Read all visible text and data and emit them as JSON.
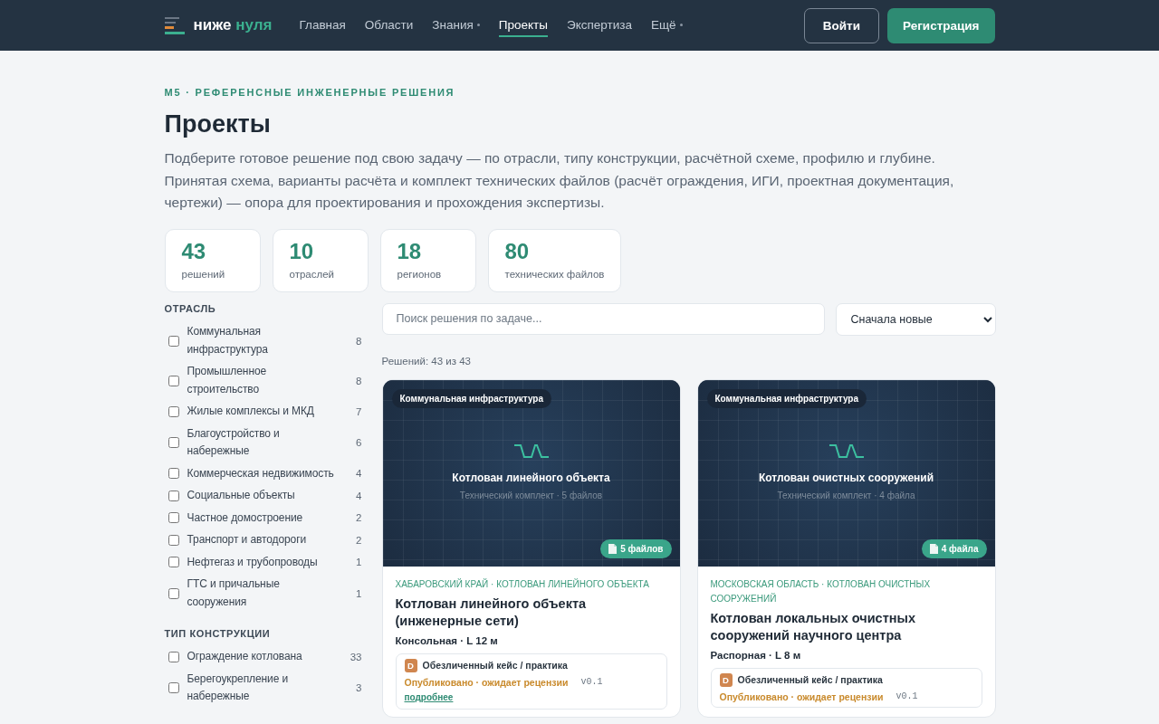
{
  "header": {
    "logo": {
      "word1": "ниже",
      "word2": "нуля"
    },
    "nav": [
      {
        "label": "Главная",
        "selected": false,
        "dropdown": false
      },
      {
        "label": "Области",
        "selected": false,
        "dropdown": false
      },
      {
        "label": "Знания",
        "selected": false,
        "dropdown": true
      },
      {
        "label": "Проекты",
        "selected": true,
        "dropdown": false
      },
      {
        "label": "Экспертиза",
        "selected": false,
        "dropdown": false
      },
      {
        "label": "Ещё",
        "selected": false,
        "dropdown": true
      }
    ],
    "login": "Войти",
    "register": "Регистрация"
  },
  "eyebrow": "M5 · РЕФЕРЕНСНЫЕ ИНЖЕНЕРНЫЕ РЕШЕНИЯ",
  "title": "Проекты",
  "intro": "Подберите готовое решение под свою задачу — по отрасли, типу конструкции, расчётной схеме, профилю и глубине. Принятая схема, варианты расчёта и комплект технических файлов (расчёт ограждения, ИГИ, проектная документация, чертежи) — опора для проектирования и прохождения экспертизы.",
  "stats": [
    {
      "value": "43",
      "label": "решений"
    },
    {
      "value": "10",
      "label": "отраслей"
    },
    {
      "value": "18",
      "label": "регионов"
    },
    {
      "value": "80",
      "label": "технических файлов"
    }
  ],
  "filters": [
    {
      "title": "ОТРАСЛЬ",
      "items": [
        {
          "label": "Коммунальная инфраструктура",
          "count": "8",
          "checked": false
        },
        {
          "label": "Промышленное строительство",
          "count": "8",
          "checked": false
        },
        {
          "label": "Жилые комплексы и МКД",
          "count": "7",
          "checked": false
        },
        {
          "label": "Благоустройство и набережные",
          "count": "6",
          "checked": false
        },
        {
          "label": "Коммерческая недвижимость",
          "count": "4",
          "checked": false
        },
        {
          "label": "Социальные объекты",
          "count": "4",
          "checked": false
        },
        {
          "label": "Частное домостроение",
          "count": "2",
          "checked": false
        },
        {
          "label": "Транспорт и автодороги",
          "count": "2",
          "checked": false
        },
        {
          "label": "Нефтегаз и трубопроводы",
          "count": "1",
          "checked": false
        },
        {
          "label": "ГТС и причальные сооружения",
          "count": "1",
          "checked": false
        }
      ]
    },
    {
      "title": "ТИП КОНСТРУКЦИИ",
      "items": [
        {
          "label": "Ограждение котлована",
          "count": "33",
          "checked": false
        },
        {
          "label": "Берегоукрепление и набережные",
          "count": "3",
          "checked": false
        }
      ]
    }
  ],
  "search": {
    "placeholder": "Поиск решения по задаче..."
  },
  "sort": {
    "value": "Сначала новые"
  },
  "result_count": "Решений: 43 из 43",
  "cards": [
    {
      "category": "Коммунальная инфраструктура",
      "cover_title": "Котлован линейного объекта",
      "cover_subtitle": "Технический комплект · 5 файлов",
      "files": "5 файлов",
      "meta": "ХАБАРОВСКИЙ КРАЙ · КОТЛОВАН ЛИНЕЙНОГО ОБЪЕКТА",
      "title": "Котлован линейного объекта (инженерные сети)",
      "spec": "Консольная · L 12 м",
      "source": {
        "badge": "D",
        "label": "Обезличенный кейс / практика",
        "status": "Опубликовано · ожидает рецензии",
        "version": "v0.1",
        "link": "подробнее"
      }
    },
    {
      "category": "Коммунальная инфраструктура",
      "cover_title": "Котлован очистных сооружений",
      "cover_subtitle": "Технический комплект · 4 файла",
      "files": "4 файла",
      "meta": "МОСКОВСКАЯ ОБЛАСТЬ · КОТЛОВАН ОЧИСТНЫХ СООРУЖЕНИЙ",
      "title": "Котлован локальных очистных сооружений научного центра",
      "spec": "Распорная · L 8 м",
      "source": {
        "badge": "D",
        "label": "Обезличенный кейс / практика",
        "status": "Опубликовано · ожидает рецензии",
        "version": "v0.1"
      }
    }
  ]
}
